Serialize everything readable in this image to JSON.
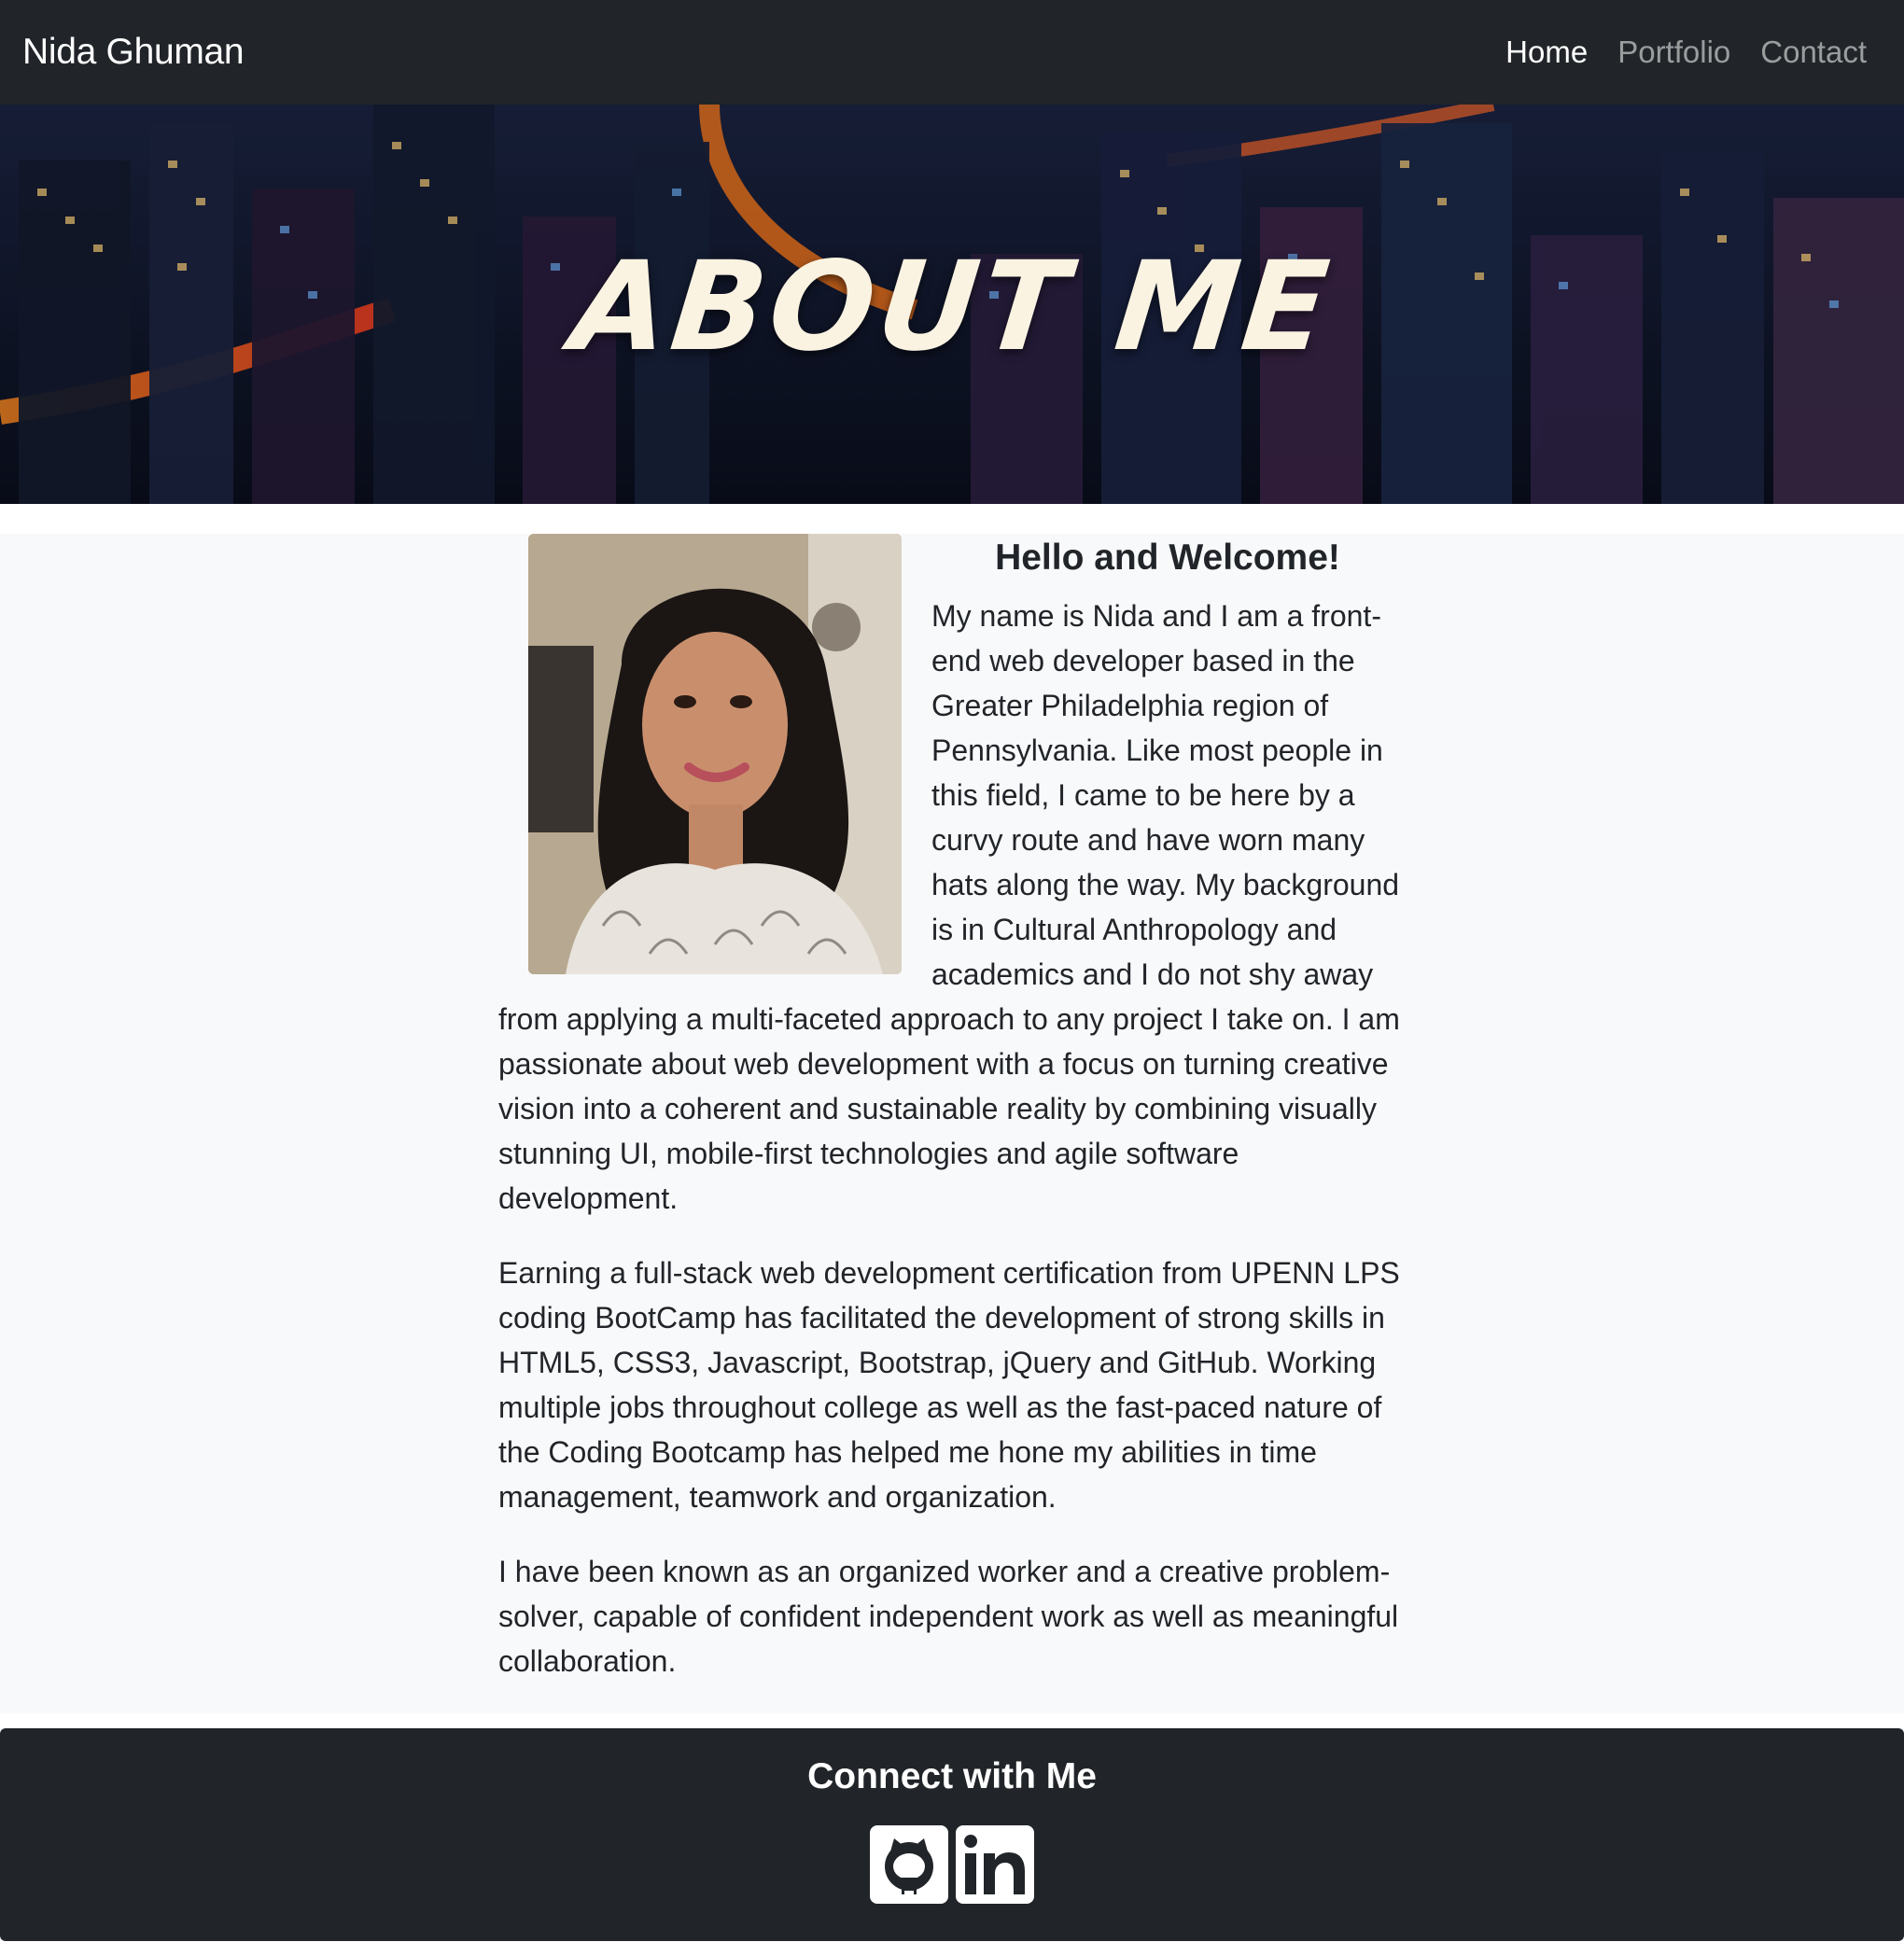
{
  "navbar": {
    "brand": "Nida Ghuman",
    "links": [
      {
        "label": "Home",
        "active": true
      },
      {
        "label": "Portfolio",
        "active": false
      },
      {
        "label": "Contact",
        "active": false
      }
    ]
  },
  "hero": {
    "title": "ABOUT ME",
    "background": "city-at-night-image"
  },
  "about": {
    "heading": "Hello and Welcome!",
    "paragraphs": [
      "My name is Nida and I am a front-end web developer based in the Greater Philadelphia region of Pennsylvania. Like most people in this field, I came to be here by a curvy route and have worn many hats along the way. My background is in Cultural Anthropology and academics and I do not shy away from applying a multi-faceted approach to any project I take on. I am passionate about web development with a focus on turning creative vision into a coherent and sustainable reality by combining visually stunning UI, mobile-first technologies and agile software development.",
      "Earning a full-stack web development certification from UPENN LPS coding BootCamp has facilitated the development of strong skills in HTML5, CSS3, Javascript, Bootstrap, jQuery and GitHub. Working multiple jobs throughout college as well as the fast-paced nature of the Coding Bootcamp has helped me hone my abilities in time management, teamwork and organization.",
      "I have been known as an organized worker and a creative problem-solver, capable of confident independent work as well as meaningful collaboration."
    ]
  },
  "footer": {
    "title": "Connect with Me",
    "icons": [
      "github-icon",
      "linkedin-icon"
    ]
  },
  "colors": {
    "navbar_bg": "#212529",
    "section_bg": "#f8f9fa",
    "text": "#212529"
  }
}
